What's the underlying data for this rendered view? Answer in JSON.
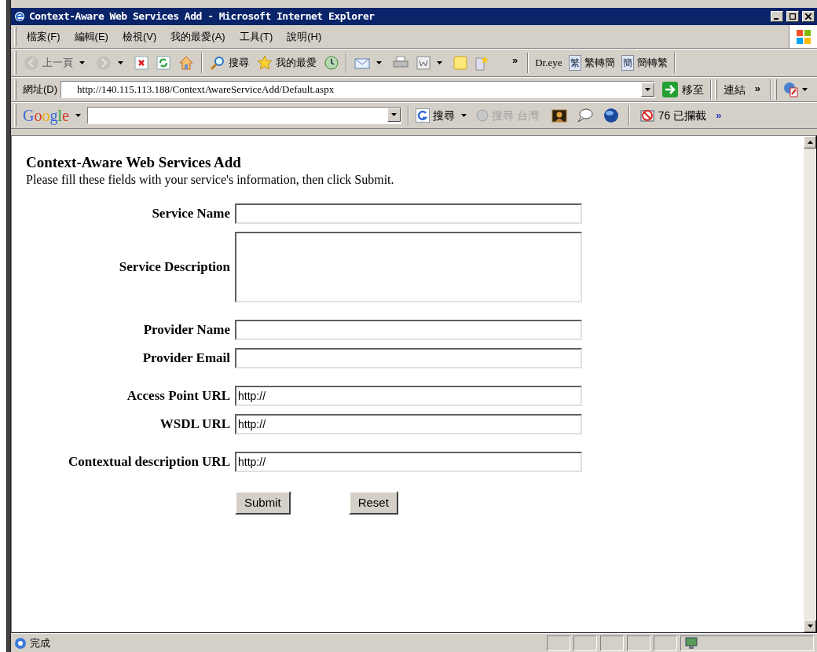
{
  "window": {
    "title": "Context-Aware Web Services Add - Microsoft Internet Explorer"
  },
  "menu": [
    "檔案(F)",
    "編輯(E)",
    "檢視(V)",
    "我的最愛(A)",
    "工具(T)",
    "說明(H)"
  ],
  "toolbar": [
    {
      "kind": "back",
      "label": "上一頁",
      "dropdown": true,
      "disabled": true
    },
    {
      "kind": "forward",
      "dropdown": true,
      "disabled": true
    },
    {
      "kind": "stop",
      "dropdown": false,
      "disabled": false
    },
    {
      "kind": "refresh",
      "dropdown": false,
      "disabled": false
    },
    {
      "kind": "home",
      "dropdown": false,
      "disabled": false
    },
    {
      "kind": "separator"
    },
    {
      "kind": "search",
      "label": "搜尋",
      "dropdown": false,
      "disabled": false
    },
    {
      "kind": "favorites",
      "label": "我的最愛",
      "dropdown": false,
      "disabled": false
    },
    {
      "kind": "history",
      "dropdown": false,
      "disabled": false
    },
    {
      "kind": "separator"
    },
    {
      "kind": "mail",
      "dropdown": true,
      "disabled": false
    },
    {
      "kind": "print",
      "dropdown": false,
      "disabled": false
    },
    {
      "kind": "word",
      "dropdown": true,
      "disabled": false
    },
    {
      "kind": "note",
      "dropdown": false,
      "disabled": false
    },
    {
      "kind": "star-doc",
      "dropdown": false,
      "disabled": false
    },
    {
      "kind": "more",
      "label": "»"
    }
  ],
  "dreye": {
    "label": "Dr.eye",
    "buttons": [
      {
        "glyph": "繁",
        "label": "繁轉簡"
      },
      {
        "glyph": "簡",
        "label": "簡轉繁"
      }
    ]
  },
  "address": {
    "label": "網址(D)",
    "value": "http://140.115.113.188/ContextAwareServiceAdd/Default.aspx",
    "go": "移至",
    "links": "連結",
    "links_more": "»"
  },
  "google": {
    "logo": "Google",
    "search": "搜尋",
    "search_taiwan": "搜尋 台灣",
    "blocked": "76 已攔截",
    "more": "»"
  },
  "page": {
    "heading": "Context-Aware Web Services Add",
    "intro": "Please fill these fields with your service's information, then click Submit.",
    "groups": [
      [
        {
          "label": "Service Name",
          "kind": "text"
        },
        {
          "label": "Service Description",
          "kind": "textarea"
        }
      ],
      [
        {
          "label": "Provider Name",
          "kind": "text"
        },
        {
          "label": "Provider Email",
          "kind": "text"
        }
      ],
      [
        {
          "label": "Access Point URL",
          "kind": "text",
          "value": "http://"
        },
        {
          "label": "WSDL URL",
          "kind": "text",
          "value": "http://"
        }
      ],
      [
        {
          "label": "Contextual description URL",
          "kind": "text",
          "value": "http://"
        }
      ]
    ],
    "buttons": [
      "Submit",
      "Reset"
    ]
  },
  "status_bar": {
    "text": "完成"
  }
}
